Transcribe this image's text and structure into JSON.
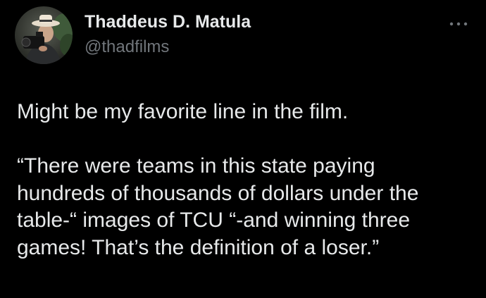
{
  "author": {
    "display_name": "Thaddeus D. Matula",
    "handle": "@thadfilms",
    "avatar_icon": "profile-photo-man-with-camera"
  },
  "more_icon": "more-options-icon",
  "tweet": {
    "lines": [
      "Might be my favorite line in the film.",
      "“There were teams in this state paying",
      "hundreds of thousands of dollars under the",
      "table-“ images of TCU “-and winning three",
      "games! That’s the definition of a loser.”"
    ]
  },
  "colors": {
    "background": "#000000",
    "primary_text": "#e7e9ea",
    "secondary_text": "#71767b"
  }
}
